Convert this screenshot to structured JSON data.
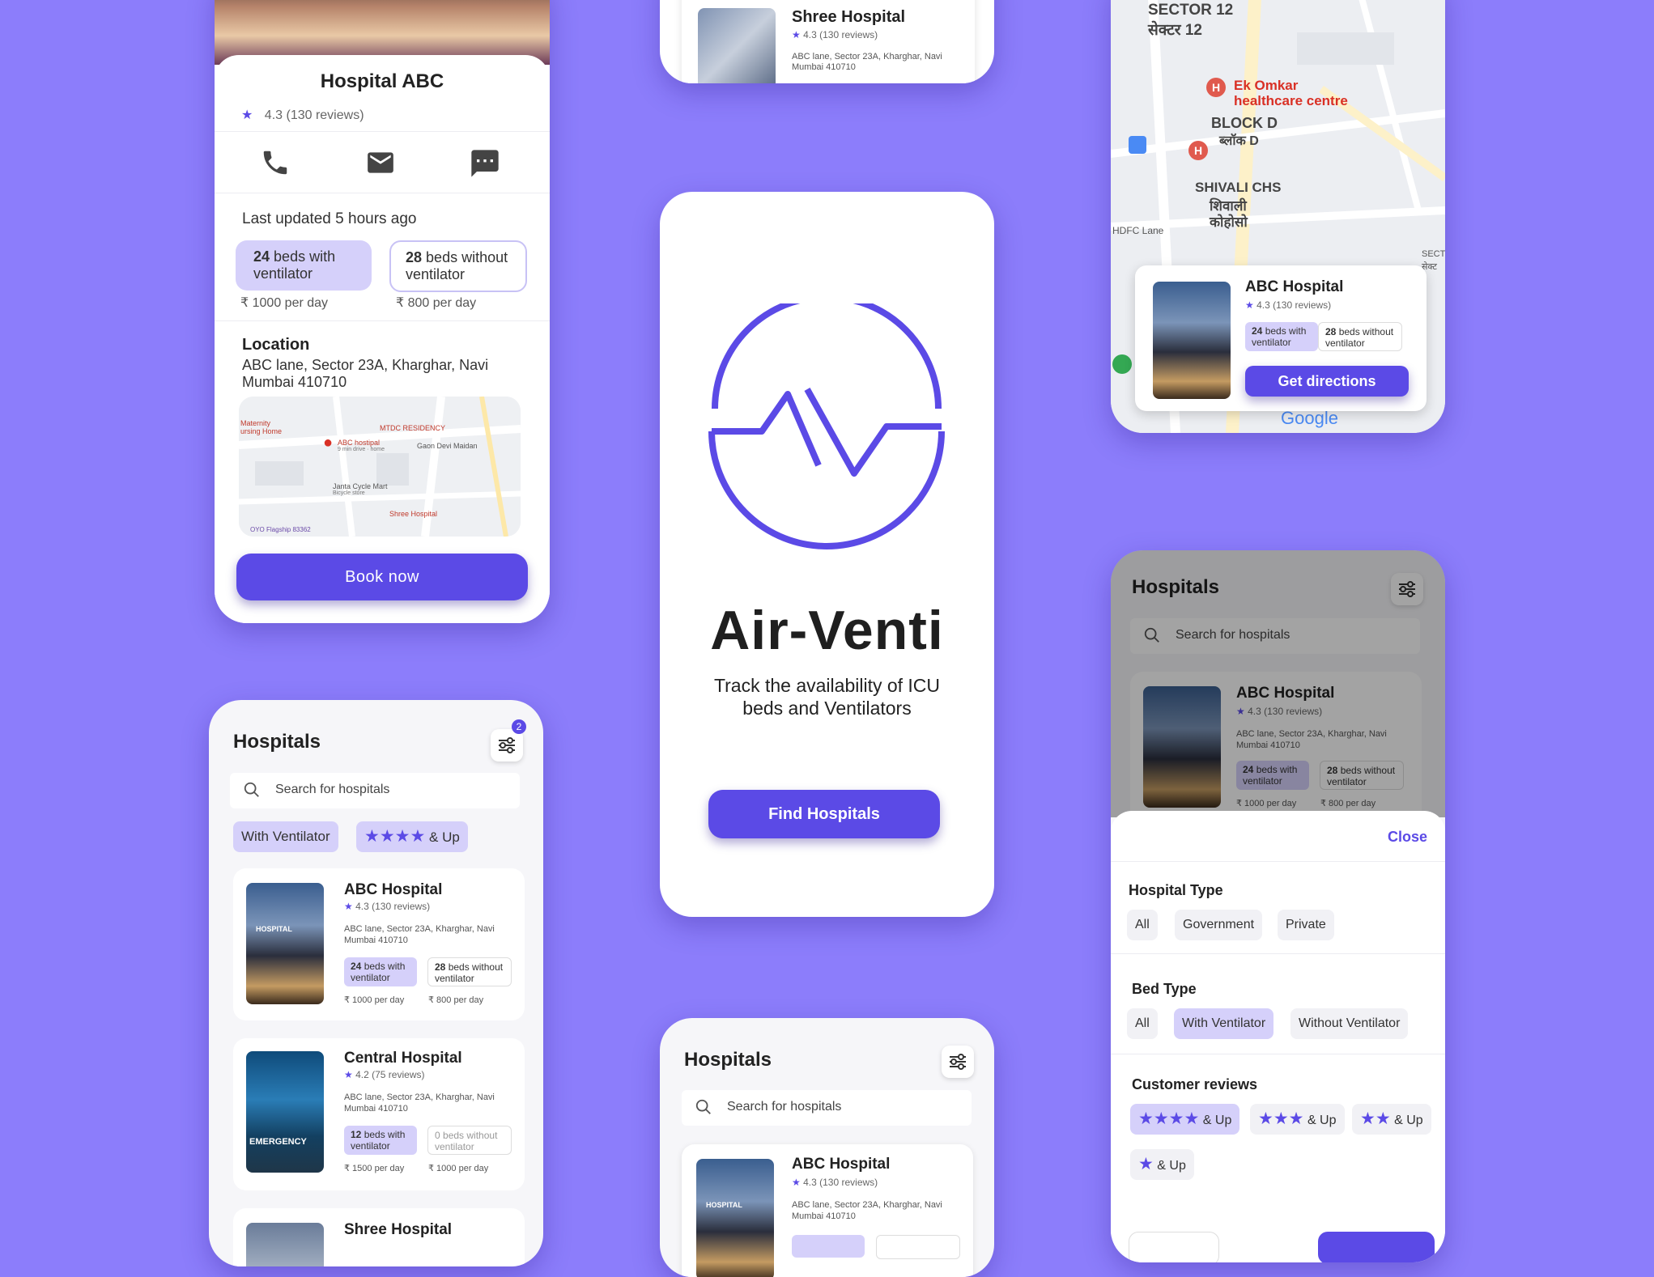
{
  "detail": {
    "title": "Hospital ABC",
    "rating": "4.3 (130 reviews)",
    "last_updated": "Last updated 5 hours ago",
    "bed1_count": "24",
    "bed1_label": "beds with ventilator",
    "bed2_count": "28",
    "bed2_label": "beds without ventilator",
    "price1": "₹ 1000 per day",
    "price2": "₹ 800 per day",
    "location_heading": "Location",
    "location_address": "ABC lane, Sector 23A,  Kharghar, Navi Mumbai 410710",
    "map_labels": [
      "Maternity",
      "ursing Home",
      "MTDC RESIDENCY",
      "ABC hostipal",
      "9 min drive · home",
      "Gaon Devi Maidan",
      "Janta Cycle Mart",
      "Bicycle store",
      "Shree Hospital",
      "OYO Flagship 83362"
    ],
    "book_button": "Book  now"
  },
  "top_list": {
    "name": "Shree Hospital",
    "rating": "4.3 (130 reviews)",
    "address": "ABC lane, Sector 23A,  Kharghar, Navi Mumbai 410710"
  },
  "map_screen": {
    "map_labels": [
      "SECTOR 12",
      "सेक्टर 12",
      "Ek Omkar",
      "healthcare centre",
      "BLOCK D",
      "ब्लॉक D",
      "SHIVALI CHS",
      "शिवाली",
      "कोहोसो",
      "HDFC Lane",
      "SECT",
      "सेक्ट",
      "Google"
    ],
    "card_name": "ABC Hospital",
    "card_rating": "4.3 (130 reviews)",
    "pill1_count": "24",
    "pill1_label": "beds with ventilator",
    "pill2_count": "28",
    "pill2_label": "beds without ventilator",
    "directions_button": "Get directions"
  },
  "splash": {
    "app_name": "Air-Venti",
    "tagline_line1": "Track the availability of ICU",
    "tagline_line2": "beds and Ventilators",
    "find_button": "Find Hospitals",
    "brand_color": "#5b4ae6"
  },
  "list_screen": {
    "title": "Hospitals",
    "filter_badge": "2",
    "search_placeholder": "Search for hospitals",
    "chip_ventilator": "With Ventilator",
    "chip_rating_suffix": "& Up",
    "hospitals": [
      {
        "name": "ABC Hospital",
        "rating": "4.3 (130 reviews)",
        "address": "ABC lane, Sector 23A,  Kharghar, Navi Mumbai 410710",
        "with_count": "24",
        "with_label": "beds with ventilator",
        "without_count": "28",
        "without_label": "beds without ventilator",
        "price_with": "₹ 1000 per day",
        "price_without": "₹ 800 per day",
        "image_text": "HOSPITAL"
      },
      {
        "name": "Central Hospital",
        "rating": "4.2 (75 reviews)",
        "address": "ABC lane, Sector 23A,  Kharghar, Navi Mumbai 410710",
        "with_count": "12",
        "with_label": "beds with ventilator",
        "without_count": "0",
        "without_label": "beds without ventilator",
        "price_with": "₹ 1500 per day",
        "price_without": "₹ 1000 per day",
        "image_text": "EMERGENCY"
      },
      {
        "name": "Shree Hospital"
      }
    ]
  },
  "bottom_list": {
    "title": "Hospitals",
    "search_placeholder": "Search for hospitals",
    "name": "ABC Hospital",
    "rating": "4.3 (130 reviews)",
    "address": "ABC lane, Sector 23A,  Kharghar, Navi Mumbai 410710",
    "image_text": "HOSPITAL"
  },
  "filter_screen": {
    "title": "Hospitals",
    "search_placeholder": "Search for hospitals",
    "card_name": "ABC Hospital",
    "card_rating": "4.3 (130 reviews)",
    "card_address": "ABC lane, Sector 23A,  Kharghar, Navi Mumbai 410710",
    "card_with_count": "24",
    "card_with_label": "beds with ventilator",
    "card_without_count": "28",
    "card_without_label": "beds without ventilator",
    "card_price_with": "₹ 1000 per day",
    "card_price_without": "₹ 800 per day",
    "close": "Close",
    "type_heading": "Hospital Type",
    "type_options": [
      "All",
      "Government",
      "Private"
    ],
    "bed_heading": "Bed Type",
    "bed_options": [
      "All",
      "With Ventilator",
      "Without Ventilator"
    ],
    "reviews_heading": "Customer  reviews",
    "up_suffix": "& Up"
  }
}
